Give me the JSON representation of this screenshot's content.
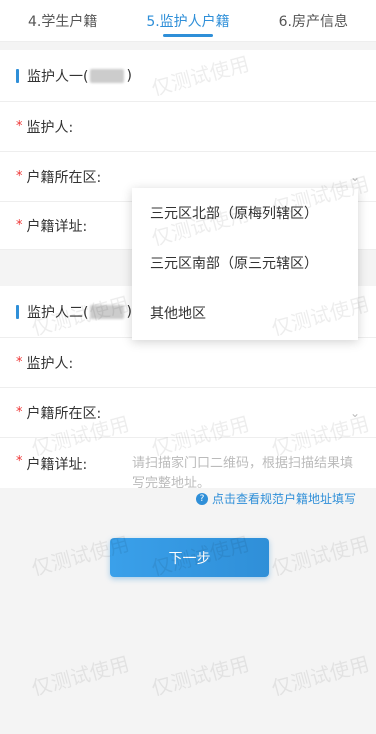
{
  "tabs": [
    {
      "label": "4.学生户籍",
      "active": false
    },
    {
      "label": "5.监护人户籍",
      "active": true
    },
    {
      "label": "6.房产信息",
      "active": false
    }
  ],
  "guardian1": {
    "title": "监护人一(",
    "title_suffix": ")",
    "guardian_label": "监护人:",
    "district_label": "户籍所在区:",
    "detail_label": "户籍详址:"
  },
  "guardian2": {
    "title": "监护人二(",
    "title_suffix": ")",
    "guardian_label": "监护人:",
    "district_label": "户籍所在区:",
    "detail_label": "户籍详址:",
    "detail_placeholder": "请扫描家门口二维码，根据扫描结果填写完整地址。"
  },
  "dropdown": {
    "options": [
      "三元区北部（原梅列辖区）",
      "三元区南部（原三元辖区）",
      "其他地区"
    ]
  },
  "hint": {
    "text": "点击查看规范户籍地址填写",
    "icon": "question-circle-icon"
  },
  "next_button": {
    "label": "下一步"
  },
  "watermark": {
    "text": "仅测试使用"
  },
  "required_mark": "*",
  "colors": {
    "accent": "#2f8fd8",
    "required": "#e33333"
  }
}
